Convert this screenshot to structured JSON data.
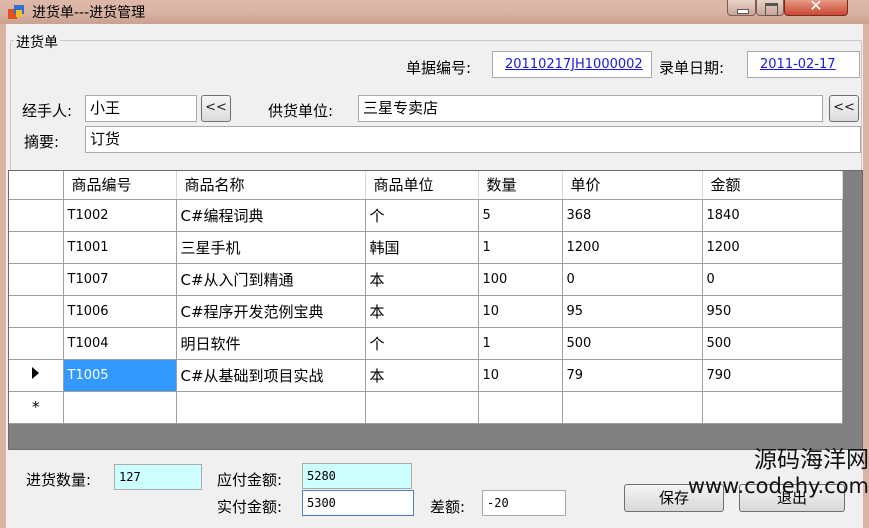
{
  "window": {
    "title": "进货单---进货管理",
    "close_glyph": "✕"
  },
  "group": {
    "title": "进货单"
  },
  "form": {
    "bill_no_label": "单据编号:",
    "bill_no_value": "20110217JH1000002",
    "date_label": "录单日期:",
    "date_value": "2011-02-17",
    "handler_label": "经手人:",
    "handler_value": "小王",
    "supplier_label": "供货单位:",
    "supplier_value": "三星专卖店",
    "summary_label": "摘要:",
    "summary_value": "订货",
    "pick_glyph": "<<"
  },
  "grid": {
    "columns": [
      "商品编号",
      "商品名称",
      "商品单位",
      "数量",
      "单价",
      "金额"
    ],
    "rows": [
      [
        "T1002",
        "C#编程词典",
        "个",
        "5",
        "368",
        "1840"
      ],
      [
        "T1001",
        "三星手机",
        "韩国",
        "1",
        "1200",
        "1200"
      ],
      [
        "T1007",
        "C#从入门到精通",
        "本",
        "100",
        "0",
        "0"
      ],
      [
        "T1006",
        "C#程序开发范例宝典",
        "本",
        "10",
        "95",
        "950"
      ],
      [
        "T1004",
        "明日软件",
        "个",
        "1",
        "500",
        "500"
      ],
      [
        "T1005",
        "C#从基础到项目实战",
        "本",
        "10",
        "79",
        "790"
      ]
    ],
    "current_row_index": 5,
    "new_row_glyph": "*"
  },
  "summary": {
    "qty_label": "进货数量:",
    "qty_value": "127",
    "payable_label": "应付金额:",
    "payable_value": "5280",
    "paid_label": "实付金额:",
    "paid_value": "5300",
    "diff_label": "差额:",
    "diff_value": "-20"
  },
  "buttons": {
    "save_label": "保存",
    "second_label": "退出"
  },
  "watermark": {
    "name": "源码海洋网",
    "url": "www.codehy.com"
  },
  "colors": {
    "selection": "#3399ff",
    "readonly_field": "#ccffff",
    "link_text": "#1a1ad6"
  }
}
